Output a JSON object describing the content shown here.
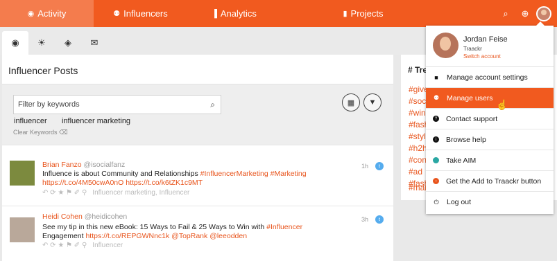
{
  "nav": {
    "items": [
      {
        "label": "Activity",
        "icon": "rss-icon",
        "glyph": "◉"
      },
      {
        "label": "Influencers",
        "icon": "people-icon",
        "glyph": "⚉"
      },
      {
        "label": "Analytics",
        "icon": "bars-icon",
        "glyph": "▐"
      },
      {
        "label": "Projects",
        "icon": "folder-icon",
        "glyph": "▮"
      }
    ],
    "right": {
      "search_glyph": "⌕",
      "add_glyph": "⊕"
    }
  },
  "tabs": [
    {
      "icon": "rss-icon",
      "glyph": "◉"
    },
    {
      "icon": "flame-icon",
      "glyph": "☀"
    },
    {
      "icon": "chat-icon",
      "glyph": "◈"
    },
    {
      "icon": "mail-icon",
      "glyph": "✉"
    }
  ],
  "main": {
    "title": "Influencer Posts",
    "filter_placeholder": "Filter by keywords",
    "keywords": [
      "influencer",
      "influencer marketing"
    ],
    "clear_label": "Clear Keywords",
    "calendar_glyph": "▦",
    "filter_glyph": "▼"
  },
  "posts": [
    {
      "author": "Brian Fanzo",
      "handle": "@isocialfanz",
      "text_plain": "Influence is about Community and Relationships ",
      "text_links": "#InfluencerMarketing #Marketing",
      "line2": "https://t.co/4M50cwA0nO https://t.co/k6tZK1c9MT",
      "tags": "Influencer marketing,  Influencer",
      "time": "1h",
      "actions": "↶  ⟳  ★  ⚑  ✐  ⚲"
    },
    {
      "author": "Heidi Cohen",
      "handle": "@heidicohen",
      "text_plain": "See my tip in this new eBook: 15 Ways to Fail & 25 Ways to Win with ",
      "text_links": "#Influencer",
      "line2_plain": "Engagement ",
      "line2_links": "https://t.co/REPGWNnc1k @TopRank @leeodden",
      "tags": "Influencer",
      "time": "3h",
      "actions": "↶  ⟳  ★  ⚑  ✐  ⚲"
    }
  ],
  "trending": {
    "title": "# Tre",
    "tags": [
      "#give",
      "#soc",
      "#win",
      "#fash",
      "#styl",
      "#h2h",
      "#con",
      "#ad",
      "#fash",
      "#mar"
    ]
  },
  "menu": {
    "name": "Jordan Feise",
    "org": "Traackr",
    "switch": "Switch account",
    "items": [
      {
        "label": "Manage account settings",
        "icon": "settings-icon",
        "glyph": "■"
      },
      {
        "label": "Manage users",
        "icon": "users-icon",
        "glyph": "⚉"
      },
      {
        "label": "Contact support",
        "icon": "help-icon",
        "glyph": "?"
      },
      {
        "label": "Browse help",
        "icon": "info-icon",
        "glyph": "i"
      },
      {
        "label": "Take AIM",
        "icon": "aim-icon",
        "glyph": "●"
      },
      {
        "label": "Get the Add to Traackr button",
        "icon": "traackr-icon",
        "glyph": "➖"
      },
      {
        "label": "Log out",
        "icon": "power-icon",
        "glyph": "⏻"
      }
    ]
  },
  "colors": {
    "accent": "#f15a1f",
    "link": "#e8541c",
    "twitter": "#55acee"
  }
}
